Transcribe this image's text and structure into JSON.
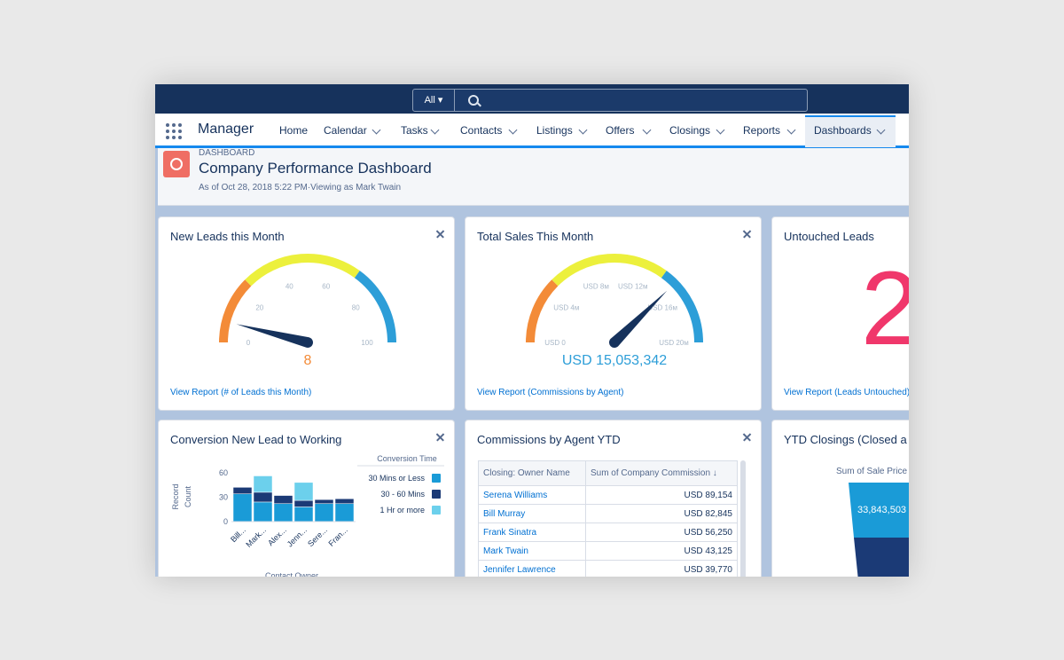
{
  "topbar": {
    "search_scope": "All ▾"
  },
  "nav": {
    "app_name": "Manager",
    "items": [
      {
        "label": "Home"
      },
      {
        "label": "Calendar"
      },
      {
        "label": "Tasks"
      },
      {
        "label": "Contacts"
      },
      {
        "label": "Listings"
      },
      {
        "label": "Offers"
      },
      {
        "label": "Closings"
      },
      {
        "label": "Reports"
      },
      {
        "label": "Dashboards"
      }
    ],
    "active": "Dashboards"
  },
  "header": {
    "eyebrow": "DASHBOARD",
    "title": "Company Performance Dashboard",
    "as_of": "As of Oct 28, 2018 5:22 PM·Viewing as Mark Twain"
  },
  "colors": {
    "accent": "#1589ee",
    "navy": "#16325c",
    "orange": "#f38b38",
    "yellow": "#ecf03c",
    "blue": "#2d9ed8",
    "pink": "#f0376b"
  },
  "cards": {
    "new_leads": {
      "title": "New Leads this Month",
      "link": "View Report (# of Leads this Month)"
    },
    "total_sales": {
      "title": "Total Sales This Month",
      "link": "View Report (Commissions by Agent)"
    },
    "untouched": {
      "title": "Untouched Leads",
      "value": "2",
      "link": "View Report (Leads Untouched)"
    },
    "conversion": {
      "title": "Conversion New Lead to Working",
      "legend_title": "Conversion Time",
      "y_axis_label": "Record Count",
      "x_axis_label": "Contact Owner"
    },
    "commissions": {
      "title": "Commissions by Agent YTD",
      "col1": "Closing: Owner Name",
      "col2": "Sum of Company Commission ↓",
      "rows": [
        {
          "name": "Serena Williams",
          "value": "USD 89,154"
        },
        {
          "name": "Bill Murray",
          "value": "USD 82,845"
        },
        {
          "name": "Frank Sinatra",
          "value": "USD 56,250"
        },
        {
          "name": "Mark Twain",
          "value": "USD 43,125"
        },
        {
          "name": "Jennifer Lawrence",
          "value": "USD 39,770"
        }
      ]
    },
    "ytd_closings": {
      "title": "YTD Closings (Closed a",
      "label": "Sum of Sale Price",
      "value": "33,843,503"
    }
  },
  "chart_data": [
    {
      "type": "gauge",
      "title": "New Leads this Month",
      "min": 0,
      "max": 100,
      "ticks": [
        "0",
        "20",
        "40",
        "60",
        "80",
        "100"
      ],
      "tick_values": [
        0,
        20,
        40,
        60,
        80,
        100
      ],
      "bands": [
        {
          "to": 25,
          "color": "#f38b38"
        },
        {
          "to": 70,
          "color": "#ecf03c"
        },
        {
          "to": 100,
          "color": "#2d9ed8"
        }
      ],
      "value": 8,
      "value_label": "8",
      "value_color": "#f38b38"
    },
    {
      "type": "gauge",
      "title": "Total Sales This Month",
      "min": 0,
      "max": 20000000,
      "ticks": [
        "USD 0",
        "USD 4м",
        "USD 8м",
        "USD 12м",
        "USD 16м",
        "USD 20м"
      ],
      "tick_values": [
        0,
        4000000,
        8000000,
        12000000,
        16000000,
        20000000
      ],
      "bands": [
        {
          "to": 5000000,
          "color": "#f38b38"
        },
        {
          "to": 14000000,
          "color": "#ecf03c"
        },
        {
          "to": 20000000,
          "color": "#2d9ed8"
        }
      ],
      "value": 15053342,
      "value_label": "USD 15,053,342",
      "value_color": "#2d9ed8"
    },
    {
      "type": "bar",
      "stacked": true,
      "title": "Conversion New Lead to Working",
      "categories": [
        "Bill...",
        "Mark...",
        "Alex...",
        "Jenn...",
        "Sere...",
        "Fran..."
      ],
      "ylabel": "Record Count",
      "yticks": [
        0,
        30,
        60
      ],
      "ylim": [
        0,
        65
      ],
      "series": [
        {
          "name": "30 Mins or Less",
          "color": "#1a9bd7",
          "values": [
            34,
            24,
            22,
            18,
            22,
            22
          ]
        },
        {
          "name": "30 - 60 Mins",
          "color": "#1b3a76",
          "values": [
            8,
            12,
            10,
            8,
            5,
            6
          ]
        },
        {
          "name": "1 Hr or more",
          "color": "#6cd0ec",
          "values": [
            0,
            20,
            0,
            22,
            0,
            0
          ]
        }
      ]
    },
    {
      "type": "funnel",
      "title": "YTD Closings (Closed a",
      "label": "Sum of Sale Price",
      "values": [
        33843503
      ]
    }
  ]
}
